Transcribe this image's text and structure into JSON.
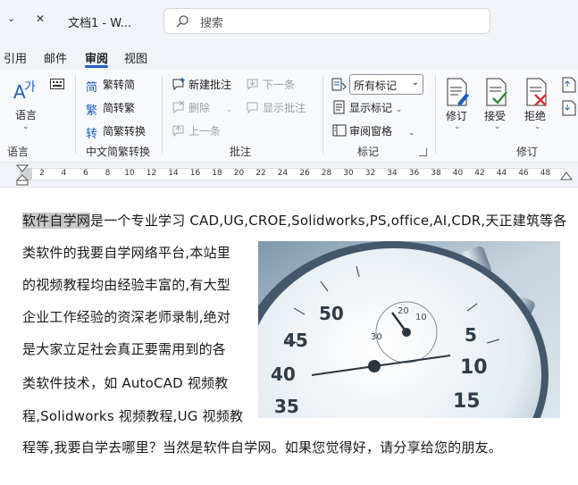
{
  "titlebar": {
    "title": "文档1  -  W...",
    "search_placeholder": "搜索"
  },
  "tabs": [
    {
      "label": "引用"
    },
    {
      "label": "邮件"
    },
    {
      "label": "审阅",
      "active": true
    },
    {
      "label": "视图"
    }
  ],
  "ribbon": {
    "language": {
      "big_button": "语言",
      "group_label": "语言"
    },
    "chinese_conversion": {
      "to_simplified": "繁转简",
      "to_traditional": "简转繁",
      "convert": "简繁转换",
      "group_label": "中文简繁转换"
    },
    "comments": {
      "new_comment": "新建批注",
      "delete": "删除",
      "previous": "上一条",
      "next": "下一条",
      "show_comments": "显示批注",
      "group_label": "批注"
    },
    "tracking": {
      "markup_select": "所有标记",
      "show_markup": "显示标记",
      "reviewing_pane": "审阅窗格",
      "group_label": "标记"
    },
    "changes": {
      "track_changes": "修订",
      "accept": "接受",
      "reject": "拒绝",
      "group_label": "修订"
    }
  },
  "ruler": {
    "ticks": [
      "2",
      "4",
      "6",
      "8",
      "10",
      "12",
      "14",
      "16",
      "18",
      "20",
      "22",
      "24",
      "26",
      "28",
      "30",
      "32",
      "34",
      "36",
      "38",
      "40",
      "42",
      "44",
      "46",
      "48"
    ]
  },
  "document": {
    "highlight_word": "软件自学网",
    "lines": [
      "是一个专业学习 CAD,UG,CROE,Solidworks,PS,office,AI,CDR,天正建筑等各",
      "类软件的我要自学网络平台,本站里",
      "的视频教程均由经验丰富的,有大型",
      "企业工作经验的资深老师录制,绝对",
      "是大家立足社会真正要需用到的各",
      "类软件技术，如 AutoCAD 视频教",
      "程,Solidworks 视频教程,UG 视频教",
      "程等,我要自学去哪里？当然是软件自学网。如果您觉得好，请分享给您的朋友。"
    ],
    "photo_numbers": [
      "50",
      "45",
      "40",
      "35",
      "10",
      "15",
      "5",
      "20",
      "10",
      "30"
    ]
  },
  "colors": {
    "accent": "#1f5fbf",
    "ribbon_bg": "#f7f9fc",
    "titlebar_bg": "#f0f3f8",
    "highlight": "#c9c9c9"
  }
}
